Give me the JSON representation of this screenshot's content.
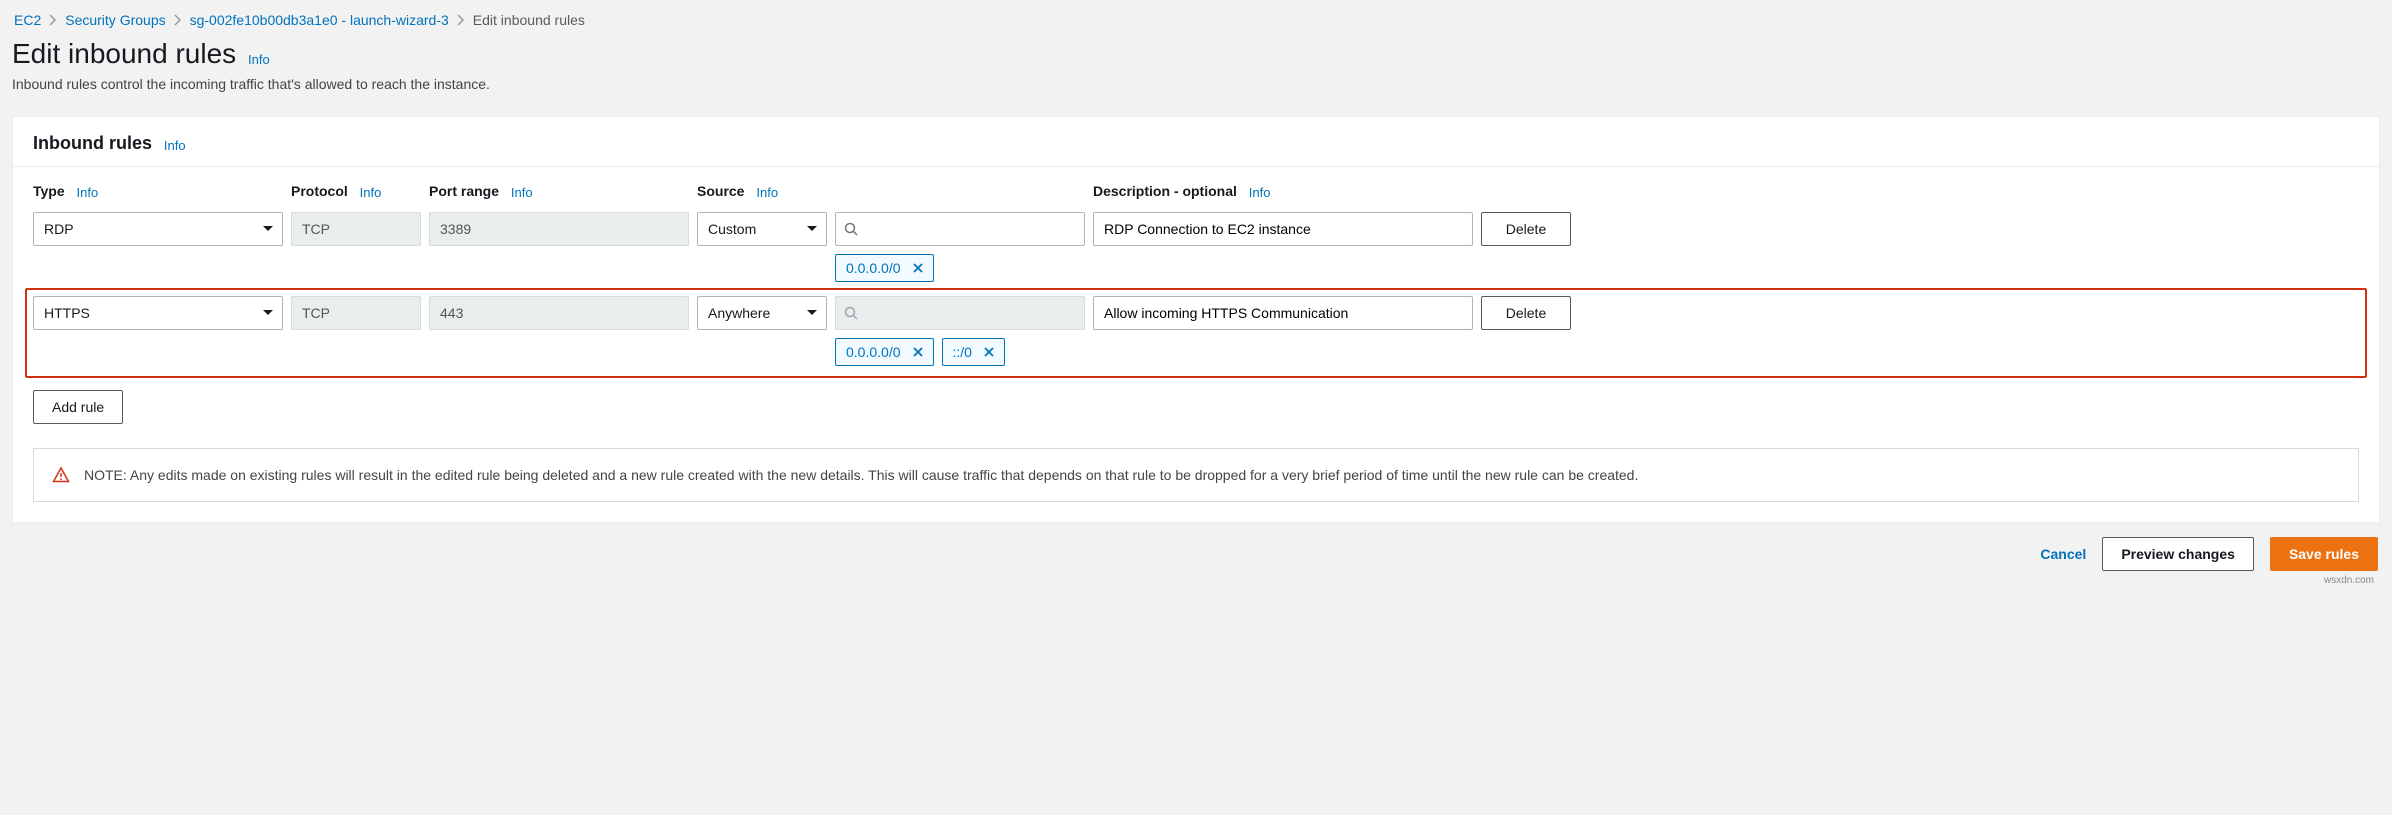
{
  "breadcrumbs": {
    "items": [
      {
        "label": "EC2"
      },
      {
        "label": "Security Groups"
      },
      {
        "label": "sg-002fe10b00db3a1e0 - launch-wizard-3"
      }
    ],
    "current": "Edit inbound rules"
  },
  "header": {
    "title": "Edit inbound rules",
    "info": "Info",
    "subtitle": "Inbound rules control the incoming traffic that's allowed to reach the instance."
  },
  "panel": {
    "title": "Inbound rules",
    "info": "Info"
  },
  "columns": {
    "type": "Type",
    "protocol": "Protocol",
    "port_range": "Port range",
    "source": "Source",
    "description": "Description - optional",
    "info": "Info"
  },
  "rules": [
    {
      "type": "RDP",
      "protocol": "TCP",
      "port_range": "3389",
      "source_mode": "Custom",
      "source_search": "",
      "cidr_tokens": [
        "0.0.0.0/0"
      ],
      "description": "RDP Connection to EC2 instance",
      "protocol_disabled": true,
      "port_disabled": true,
      "search_disabled": false,
      "highlighted": false
    },
    {
      "type": "HTTPS",
      "protocol": "TCP",
      "port_range": "443",
      "source_mode": "Anywhere",
      "source_search": "",
      "cidr_tokens": [
        "0.0.0.0/0",
        "::/0"
      ],
      "description": "Allow incoming HTTPS Communication",
      "protocol_disabled": true,
      "port_disabled": true,
      "search_disabled": true,
      "highlighted": true
    }
  ],
  "buttons": {
    "delete": "Delete",
    "add_rule": "Add rule",
    "cancel": "Cancel",
    "preview": "Preview changes",
    "save": "Save rules"
  },
  "notice": {
    "text": "NOTE: Any edits made on existing rules will result in the edited rule being deleted and a new rule created with the new details. This will cause traffic that depends on that rule to be dropped for a very brief period of time until the new rule can be created."
  },
  "attribution": "wsxdn.com"
}
